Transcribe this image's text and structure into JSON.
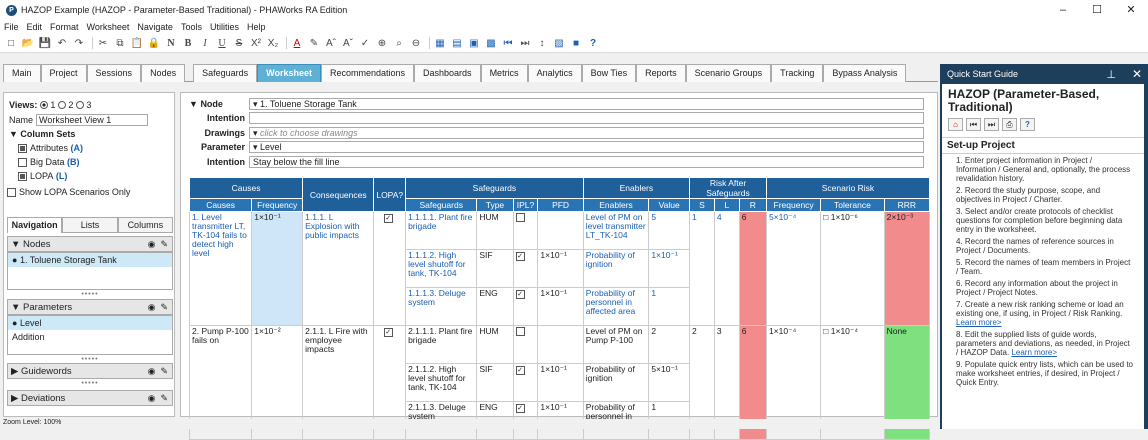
{
  "window": {
    "title": "HAZOP Example (HAZOP - Parameter-Based Traditional) - PHAWorks RA Edition",
    "app_icon_glyph": "P"
  },
  "menu": [
    "File",
    "Edit",
    "Format",
    "Worksheet",
    "Navigate",
    "Tools",
    "Utilities",
    "Help"
  ],
  "tabs": [
    "Main",
    "Project",
    "Sessions",
    "Nodes",
    "Safeguards",
    "Worksheet",
    "Recommendations",
    "Dashboards",
    "Metrics",
    "Analytics",
    "Bow Ties",
    "Reports",
    "Scenario Groups",
    "Tracking",
    "Bypass Analysis"
  ],
  "active_tab": "Worksheet",
  "left": {
    "views_label": "Views:",
    "views": [
      "1",
      "2",
      "3"
    ],
    "name_label": "Name",
    "name_value": "Worksheet View 1",
    "column_sets_label": "Column Sets",
    "column_sets": [
      {
        "label": "Attributes",
        "key": "(A)",
        "checked": true
      },
      {
        "label": "Big Data",
        "key": "(B)",
        "checked": false
      },
      {
        "label": "LOPA",
        "key": "(L)",
        "checked": true
      }
    ],
    "show_lopa": "Show LOPA Scenarios Only",
    "subtabs": [
      "Navigation",
      "Lists",
      "Columns"
    ],
    "nodes_label": "Nodes",
    "nodes": [
      "1. Toluene Storage Tank"
    ],
    "parameters_label": "Parameters",
    "parameters": [
      "Level",
      "Addition"
    ],
    "guidewords_label": "Guidewords",
    "deviations_label": "Deviations"
  },
  "form": {
    "node_label": "Node",
    "node_value": "1. Toluene Storage Tank",
    "intention_label": "Intention",
    "intention_value": "",
    "drawings_label": "Drawings",
    "drawings_placeholder": "click to choose drawings",
    "parameter_label": "Parameter",
    "parameter_value": "Level",
    "intention2_label": "Intention",
    "intention2_value": "Stay below the fill line"
  },
  "table": {
    "groups": {
      "causes": "Causes",
      "consequences": "Consequences",
      "lopa": "LOPA?",
      "safeguards": "Safeguards",
      "enablers": "Enablers",
      "risk_after": "Risk After Safeguards",
      "scenario_risk": "Scenario Risk"
    },
    "sub": {
      "causes": "Causes",
      "frequency": "Frequency",
      "safeguards": "Safeguards",
      "type": "Type",
      "ipl": "IPL?",
      "pfd": "PFD",
      "enablers": "Enablers",
      "value": "Value",
      "s": "S",
      "l": "L",
      "r": "R",
      "freq": "Frequency",
      "tolerance": "Tolerance",
      "rrr": "RRR"
    },
    "r1": {
      "cause": "1. Level transmitter LT, TK-104 fails to detect high level",
      "freq": "1×10⁻¹",
      "cons": "1.1.1. L Explosion with public impacts",
      "sg": [
        "1.1.1.1. Plant fire brigade",
        "1.1.1.2. High level shutoff for tank, TK-104",
        "1.1.1.3. Deluge system"
      ],
      "type": [
        "HUM",
        "SIF",
        "ENG"
      ],
      "pfd": [
        "",
        "1×10⁻¹",
        "1×10⁻¹"
      ],
      "en": [
        "Level of PM on level transmitter LT_TK-104",
        "Probability of ignition",
        "Probability of personnel in affected area"
      ],
      "val": [
        "5",
        "1×10⁻¹",
        "1"
      ],
      "s": "1",
      "l": "4",
      "r": "6",
      "sfreq": "5×10⁻⁴",
      "tol": "1×10⁻⁶",
      "rrr": "2×10⁻³"
    },
    "r2": {
      "cause": "2. Pump P-100 fails on",
      "freq": "1×10⁻²",
      "cons": "2.1.1. L Fire with employee impacts",
      "sg": [
        "2.1.1.1. Plant fire brigade",
        "2.1.1.2. High level shutoff for tank, TK-104",
        "2.1.1.3. Deluge system"
      ],
      "type": [
        "HUM",
        "SIF",
        "ENG"
      ],
      "pfd": [
        "",
        "1×10⁻¹",
        "1×10⁻¹"
      ],
      "en": [
        "Level of PM on Pump P-100",
        "Probability of ignition",
        "Probability of personnel in affected area"
      ],
      "val": [
        "2",
        "5×10⁻¹",
        "1"
      ],
      "s": "2",
      "l": "3",
      "r": "6",
      "sfreq": "1×10⁻⁴",
      "tol": "1×10⁻⁴",
      "rrr": "None"
    }
  },
  "quick": {
    "header": "Quick Start Guide",
    "title": "HAZOP (Parameter-Based, Traditional)",
    "section": "Set-up Project",
    "steps": [
      "1. Enter project information in Project / Information / General and, optionally, the process revalidation history.",
      "2. Record the study purpose, scope, and objectives in Project / Charter.",
      "3. Select and/or create protocols of checklist questions for completion before beginning data entry in the worksheet.",
      "4. Record the names of reference sources in Project / Documents.",
      "5. Record the names of team members in Project / Team.",
      "6. Record any information about the project in Project / Project Notes.",
      "7. Create a new risk ranking scheme or load an existing one, if using, in Project / Risk Ranking.",
      "8. Edit the supplied lists of guide words, parameters and deviations, as needed, in Project / HAZOP Data.",
      "9. Populate quick entry lists, which can be used to make worksheet entries, if desired, in Project / Quick Entry."
    ],
    "learn_more": "Learn more>"
  },
  "status": "Zoom Level: 100%",
  "colors": {
    "accent": "#5fb0d6",
    "header": "#1f5f9a",
    "risk_red": "#f28b8b",
    "risk_green": "#7fe07f"
  }
}
